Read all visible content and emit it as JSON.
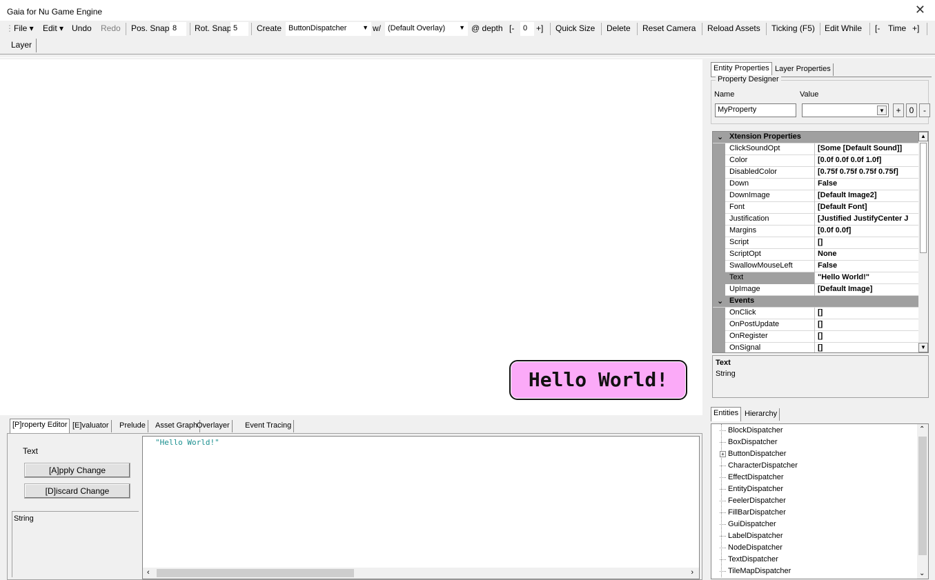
{
  "window": {
    "title": "Gaia for Nu Game Engine",
    "close_glyph": "✕"
  },
  "toolbar": {
    "file": "File ▾",
    "edit": "Edit ▾",
    "undo": "Undo",
    "redo": "Redo",
    "pos_snap_label": "Pos. Snap",
    "pos_snap_value": "8",
    "rot_snap_label": "Rot. Snap",
    "rot_snap_value": "5",
    "create_label": "Create",
    "create_value": "ButtonDispatcher",
    "with_label": "w/",
    "overlay_value": "(Default Overlay)",
    "depth_label": "@ depth",
    "depth_minus": "[-",
    "depth_value": "0",
    "depth_plus": "+]",
    "quick_size": "Quick Size",
    "delete": "Delete",
    "reset_camera": "Reset Camera",
    "reload_assets": "Reload Assets",
    "ticking": "Ticking (F5)",
    "edit_while": "Edit While",
    "time_minus": "[-",
    "time_label": "Time",
    "time_plus": "+]"
  },
  "layer_tab": "Layer",
  "viewport": {
    "button_text": "Hello World!"
  },
  "right_tabs": {
    "entity_props": "Entity Properties",
    "layer_props": "Layer Properties"
  },
  "property_designer": {
    "legend": "Property Designer",
    "name_label": "Name",
    "value_label": "Value",
    "name_value": "MyProperty",
    "plus": "+",
    "zero": "0",
    "minus": "-"
  },
  "grid": {
    "category_xtension": "Xtension Properties",
    "category_events": "Events",
    "props": [
      {
        "name": "ClickSoundOpt",
        "value": "[Some [Default Sound]]"
      },
      {
        "name": "Color",
        "value": "[0.0f 0.0f 0.0f 1.0f]"
      },
      {
        "name": "DisabledColor",
        "value": "[0.75f 0.75f 0.75f 0.75f]"
      },
      {
        "name": "Down",
        "value": "False"
      },
      {
        "name": "DownImage",
        "value": "[Default Image2]"
      },
      {
        "name": "Font",
        "value": "[Default Font]"
      },
      {
        "name": "Justification",
        "value": "[Justified JustifyCenter J"
      },
      {
        "name": "Margins",
        "value": "[0.0f 0.0f]"
      },
      {
        "name": "Script",
        "value": "[]"
      },
      {
        "name": "ScriptOpt",
        "value": "None"
      },
      {
        "name": "SwallowMouseLeft",
        "value": "False"
      },
      {
        "name": "Text",
        "value": "\"Hello World!\""
      },
      {
        "name": "UpImage",
        "value": "[Default Image]"
      }
    ],
    "events": [
      {
        "name": "OnClick",
        "value": "[]"
      },
      {
        "name": "OnPostUpdate",
        "value": "[]"
      },
      {
        "name": "OnRegister",
        "value": "[]"
      },
      {
        "name": "OnSignal",
        "value": "[]"
      }
    ],
    "selected": "Text"
  },
  "description": {
    "title": "Text",
    "type": "String"
  },
  "entity_tabs": {
    "entities": "Entities",
    "hierarchy": "Hierarchy"
  },
  "dispatchers": [
    "BlockDispatcher",
    "BoxDispatcher",
    "ButtonDispatcher",
    "CharacterDispatcher",
    "EffectDispatcher",
    "EntityDispatcher",
    "FeelerDispatcher",
    "FillBarDispatcher",
    "GuiDispatcher",
    "LabelDispatcher",
    "NodeDispatcher",
    "TextDispatcher",
    "TileMapDispatcher"
  ],
  "bottom_tabs": [
    "[P]roperty Editor",
    "[E]valuator",
    "Prelude",
    "Asset Graph",
    "Overlayer",
    "Event Tracing"
  ],
  "property_editor": {
    "prop_name": "Text",
    "apply": "[A]pply Change",
    "discard": "[D]iscard Change",
    "type": "String",
    "code": "\"Hello World!\""
  }
}
